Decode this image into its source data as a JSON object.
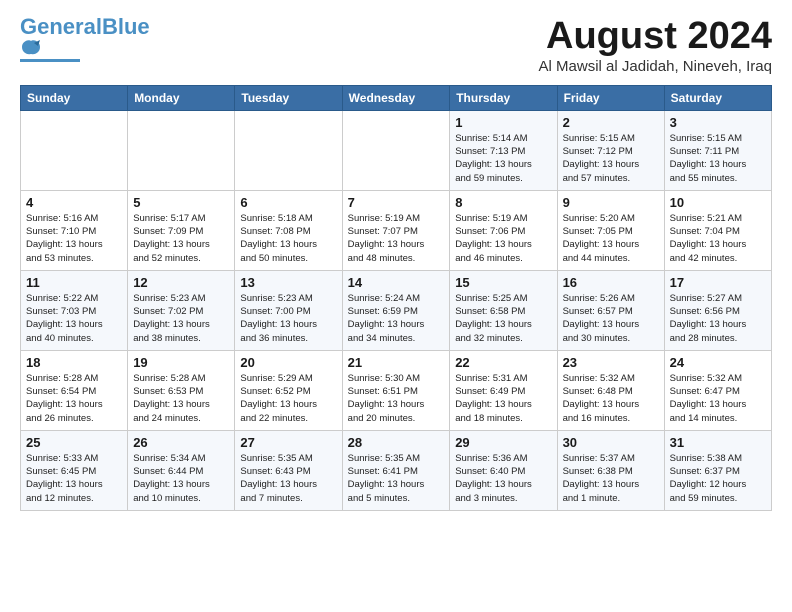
{
  "header": {
    "logo_line1": "General",
    "logo_line2": "Blue",
    "month_title": "August 2024",
    "location": "Al Mawsil al Jadidah, Nineveh, Iraq"
  },
  "days_of_week": [
    "Sunday",
    "Monday",
    "Tuesday",
    "Wednesday",
    "Thursday",
    "Friday",
    "Saturday"
  ],
  "weeks": [
    [
      {
        "num": "",
        "info": ""
      },
      {
        "num": "",
        "info": ""
      },
      {
        "num": "",
        "info": ""
      },
      {
        "num": "",
        "info": ""
      },
      {
        "num": "1",
        "info": "Sunrise: 5:14 AM\nSunset: 7:13 PM\nDaylight: 13 hours\nand 59 minutes."
      },
      {
        "num": "2",
        "info": "Sunrise: 5:15 AM\nSunset: 7:12 PM\nDaylight: 13 hours\nand 57 minutes."
      },
      {
        "num": "3",
        "info": "Sunrise: 5:15 AM\nSunset: 7:11 PM\nDaylight: 13 hours\nand 55 minutes."
      }
    ],
    [
      {
        "num": "4",
        "info": "Sunrise: 5:16 AM\nSunset: 7:10 PM\nDaylight: 13 hours\nand 53 minutes."
      },
      {
        "num": "5",
        "info": "Sunrise: 5:17 AM\nSunset: 7:09 PM\nDaylight: 13 hours\nand 52 minutes."
      },
      {
        "num": "6",
        "info": "Sunrise: 5:18 AM\nSunset: 7:08 PM\nDaylight: 13 hours\nand 50 minutes."
      },
      {
        "num": "7",
        "info": "Sunrise: 5:19 AM\nSunset: 7:07 PM\nDaylight: 13 hours\nand 48 minutes."
      },
      {
        "num": "8",
        "info": "Sunrise: 5:19 AM\nSunset: 7:06 PM\nDaylight: 13 hours\nand 46 minutes."
      },
      {
        "num": "9",
        "info": "Sunrise: 5:20 AM\nSunset: 7:05 PM\nDaylight: 13 hours\nand 44 minutes."
      },
      {
        "num": "10",
        "info": "Sunrise: 5:21 AM\nSunset: 7:04 PM\nDaylight: 13 hours\nand 42 minutes."
      }
    ],
    [
      {
        "num": "11",
        "info": "Sunrise: 5:22 AM\nSunset: 7:03 PM\nDaylight: 13 hours\nand 40 minutes."
      },
      {
        "num": "12",
        "info": "Sunrise: 5:23 AM\nSunset: 7:02 PM\nDaylight: 13 hours\nand 38 minutes."
      },
      {
        "num": "13",
        "info": "Sunrise: 5:23 AM\nSunset: 7:00 PM\nDaylight: 13 hours\nand 36 minutes."
      },
      {
        "num": "14",
        "info": "Sunrise: 5:24 AM\nSunset: 6:59 PM\nDaylight: 13 hours\nand 34 minutes."
      },
      {
        "num": "15",
        "info": "Sunrise: 5:25 AM\nSunset: 6:58 PM\nDaylight: 13 hours\nand 32 minutes."
      },
      {
        "num": "16",
        "info": "Sunrise: 5:26 AM\nSunset: 6:57 PM\nDaylight: 13 hours\nand 30 minutes."
      },
      {
        "num": "17",
        "info": "Sunrise: 5:27 AM\nSunset: 6:56 PM\nDaylight: 13 hours\nand 28 minutes."
      }
    ],
    [
      {
        "num": "18",
        "info": "Sunrise: 5:28 AM\nSunset: 6:54 PM\nDaylight: 13 hours\nand 26 minutes."
      },
      {
        "num": "19",
        "info": "Sunrise: 5:28 AM\nSunset: 6:53 PM\nDaylight: 13 hours\nand 24 minutes."
      },
      {
        "num": "20",
        "info": "Sunrise: 5:29 AM\nSunset: 6:52 PM\nDaylight: 13 hours\nand 22 minutes."
      },
      {
        "num": "21",
        "info": "Sunrise: 5:30 AM\nSunset: 6:51 PM\nDaylight: 13 hours\nand 20 minutes."
      },
      {
        "num": "22",
        "info": "Sunrise: 5:31 AM\nSunset: 6:49 PM\nDaylight: 13 hours\nand 18 minutes."
      },
      {
        "num": "23",
        "info": "Sunrise: 5:32 AM\nSunset: 6:48 PM\nDaylight: 13 hours\nand 16 minutes."
      },
      {
        "num": "24",
        "info": "Sunrise: 5:32 AM\nSunset: 6:47 PM\nDaylight: 13 hours\nand 14 minutes."
      }
    ],
    [
      {
        "num": "25",
        "info": "Sunrise: 5:33 AM\nSunset: 6:45 PM\nDaylight: 13 hours\nand 12 minutes."
      },
      {
        "num": "26",
        "info": "Sunrise: 5:34 AM\nSunset: 6:44 PM\nDaylight: 13 hours\nand 10 minutes."
      },
      {
        "num": "27",
        "info": "Sunrise: 5:35 AM\nSunset: 6:43 PM\nDaylight: 13 hours\nand 7 minutes."
      },
      {
        "num": "28",
        "info": "Sunrise: 5:35 AM\nSunset: 6:41 PM\nDaylight: 13 hours\nand 5 minutes."
      },
      {
        "num": "29",
        "info": "Sunrise: 5:36 AM\nSunset: 6:40 PM\nDaylight: 13 hours\nand 3 minutes."
      },
      {
        "num": "30",
        "info": "Sunrise: 5:37 AM\nSunset: 6:38 PM\nDaylight: 13 hours\nand 1 minute."
      },
      {
        "num": "31",
        "info": "Sunrise: 5:38 AM\nSunset: 6:37 PM\nDaylight: 12 hours\nand 59 minutes."
      }
    ]
  ]
}
